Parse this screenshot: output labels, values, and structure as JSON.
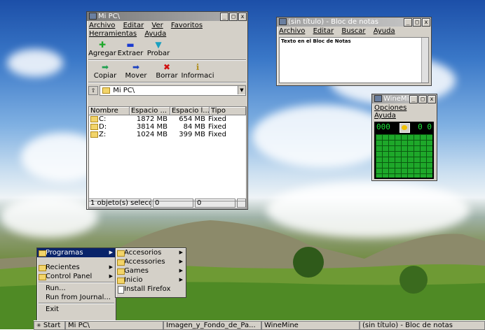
{
  "explorer": {
    "title": "Mi PC\\",
    "menu": [
      "Archivo",
      "Editar",
      "Ver",
      "Favoritos",
      "Herramientas",
      "Ayuda"
    ],
    "toolbar1": [
      "Agregar",
      "Extraer",
      "Probar"
    ],
    "toolbar2": [
      "Copiar",
      "Mover",
      "Borrar",
      "Informaci"
    ],
    "address": "Mi PC\\",
    "columns": [
      "Nombre",
      "Espacio ...",
      "Espacio l...",
      "Tipo"
    ],
    "rows": [
      {
        "name": "C:",
        "size": "1872 MB",
        "free": "654 MB",
        "type": "Fixed"
      },
      {
        "name": "D:",
        "size": "3814 MB",
        "free": "84 MB",
        "type": "Fixed"
      },
      {
        "name": "Z:",
        "size": "1024 MB",
        "free": "399 MB",
        "type": "Fixed"
      }
    ],
    "status": [
      "1 objeto(s) selecc",
      "0",
      "0"
    ]
  },
  "notepad": {
    "title": "(sin título) - Bloc de notas",
    "menu": [
      "Archivo",
      "Editar",
      "Buscar",
      "Ayuda"
    ],
    "content": "Texto en el Bloc de Notas"
  },
  "winemine": {
    "title": "WineMine",
    "menu": [
      "Opciones",
      "Ayuda"
    ],
    "mines": "000",
    "time": "0 0"
  },
  "startmenu": {
    "items": [
      "Programas",
      "Recientes",
      "Control Panel",
      "Run...",
      "Run from Journal...",
      "Exit"
    ],
    "submenu": [
      "Accesorios",
      "Accessories",
      "Games",
      "Inicio",
      "Install Firefox"
    ]
  },
  "taskbar": {
    "start": "Start",
    "tasks": [
      "Mi PC\\",
      "Imagen_y_Fondo_de_Pa...",
      "WineMine",
      "(sin título) - Bloc de notas"
    ]
  }
}
